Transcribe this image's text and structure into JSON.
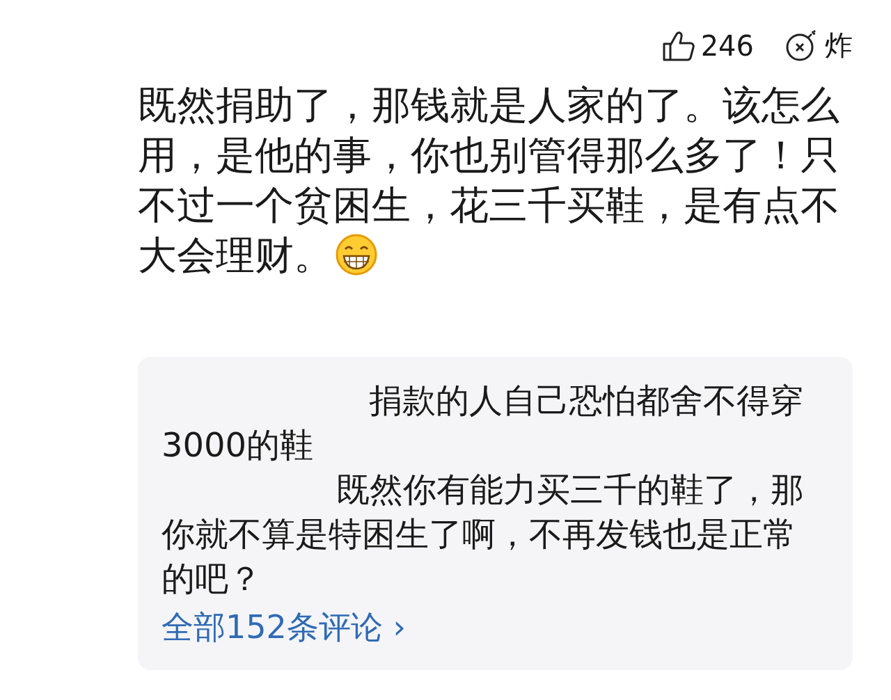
{
  "actions": [
    {
      "kind": "like",
      "label": "246"
    },
    {
      "kind": "bomb",
      "label": "炸"
    }
  ],
  "comment": {
    "text": "既然捐助了，那钱就是人家的了。该怎么用，是他的事，你也别管得那么多了！只不过一个贫困生，花三千买鞋，是有点不大会理财。"
  },
  "replies": [
    {
      "text": "捐款的人自己恐怕都舍不得穿3000的鞋"
    },
    {
      "text": "既然你有能力买三千的鞋了，那你就不算是特困生了啊，不再发钱也是正常的吧？"
    }
  ],
  "all_comments_link": {
    "label": "全部152条评论",
    "chevron": "›"
  }
}
